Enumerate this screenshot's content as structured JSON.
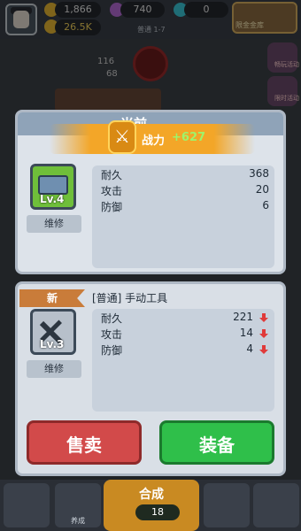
{
  "topbar": {
    "gold": "1,866",
    "gems": "740",
    "crystals": "0",
    "income": "26.5K",
    "stage": "普通 1-7",
    "gift_label": "限金金库"
  },
  "scene": {
    "numbers": [
      "116",
      "68"
    ],
    "side_labels": [
      "畅玩活动",
      "限时活动"
    ]
  },
  "current": {
    "header": "当前",
    "power_label": "战力",
    "power_delta": "+627",
    "name": "",
    "level": "Lv.4",
    "repair": "维修",
    "stats": [
      {
        "label": "耐久",
        "value": "368"
      },
      {
        "label": "攻击",
        "value": "20"
      },
      {
        "label": "防御",
        "value": "6"
      }
    ]
  },
  "new_item": {
    "tag": "新",
    "name": "[普通] 手动工具",
    "level": "Lv.3",
    "repair": "维修",
    "stats": [
      {
        "label": "耐久",
        "value": "221"
      },
      {
        "label": "攻击",
        "value": "14"
      },
      {
        "label": "防御",
        "value": "4"
      }
    ]
  },
  "buttons": {
    "sell": "售卖",
    "equip": "装备"
  },
  "bottom": {
    "merge": "合成",
    "merge_count": "18",
    "tab2": "养成"
  },
  "colors": {
    "sell": "#d24a4a",
    "equip": "#2fbf4a",
    "down_arrow": "#e03a3a",
    "power_delta": "#9ef46a"
  }
}
